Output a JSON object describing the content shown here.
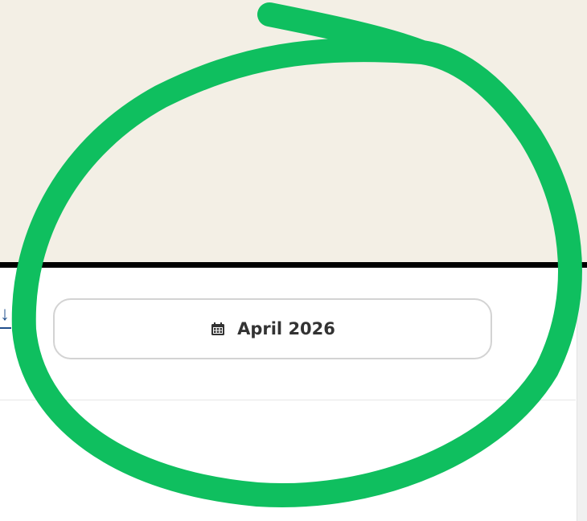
{
  "date_picker": {
    "label": "April 2026",
    "icon": "calendar-icon"
  },
  "annotation": {
    "color": "#0fbf5f"
  },
  "colors": {
    "background": "#f3efe5",
    "panel": "#ffffff",
    "frame_border": "#000000",
    "link": "#1f4e8c",
    "pill_border": "#d3d3d3",
    "text": "#333333"
  }
}
